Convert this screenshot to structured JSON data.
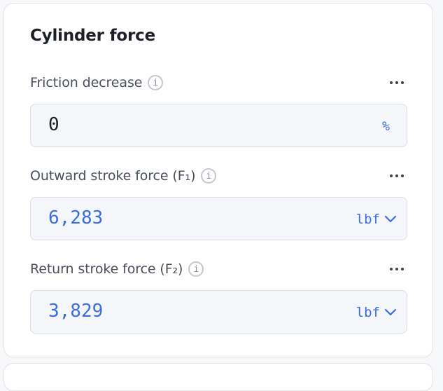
{
  "card": {
    "title": "Cylinder force"
  },
  "fields": [
    {
      "label": "Friction decrease",
      "info": "i",
      "value": "0",
      "unit": "%"
    },
    {
      "label": "Outward stroke force (F₁)",
      "info": "i",
      "value": "6,283",
      "unit": "lbf"
    },
    {
      "label": "Return stroke force (F₂)",
      "info": "i",
      "value": "3,829",
      "unit": "lbf"
    }
  ],
  "colors": {
    "accent": "#3a6ee0",
    "input_bg": "#f4f6fa",
    "border": "#d9dde4",
    "text_dark": "#1c1f26",
    "label": "#494f5a"
  },
  "icons": {
    "info": "info-icon",
    "more": "more-horizontal-icon",
    "dropdown": "chevron-down-icon"
  }
}
